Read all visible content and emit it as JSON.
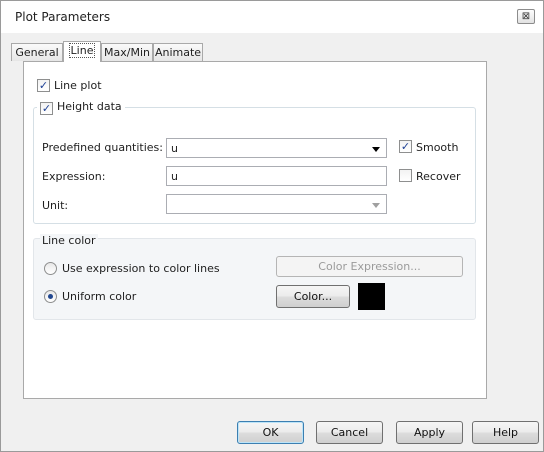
{
  "window": {
    "title": "Plot Parameters",
    "close_glyph": "⊠"
  },
  "tabs": [
    {
      "label": "General"
    },
    {
      "label": "Line"
    },
    {
      "label": "Max/Min"
    },
    {
      "label": "Animate"
    }
  ],
  "line_plot": {
    "label": "Line plot",
    "checked": true
  },
  "height_data": {
    "label": "Height data",
    "checked": true,
    "predefined_label": "Predefined quantities:",
    "predefined_value": "u",
    "expression_label": "Expression:",
    "expression_value": "u",
    "unit_label": "Unit:",
    "unit_value": "",
    "smooth_label": "Smooth",
    "smooth_checked": true,
    "recover_label": "Recover",
    "recover_checked": false
  },
  "line_color": {
    "title": "Line color",
    "use_expression_label": "Use expression to color lines",
    "uniform_label": "Uniform color",
    "selected": "uniform",
    "color_expression_button": "Color Expression...",
    "color_button": "Color...",
    "swatch_color": "#000000"
  },
  "buttons": {
    "ok": "OK",
    "cancel": "Cancel",
    "apply": "Apply",
    "help": "Help"
  },
  "check_glyph": "✓"
}
